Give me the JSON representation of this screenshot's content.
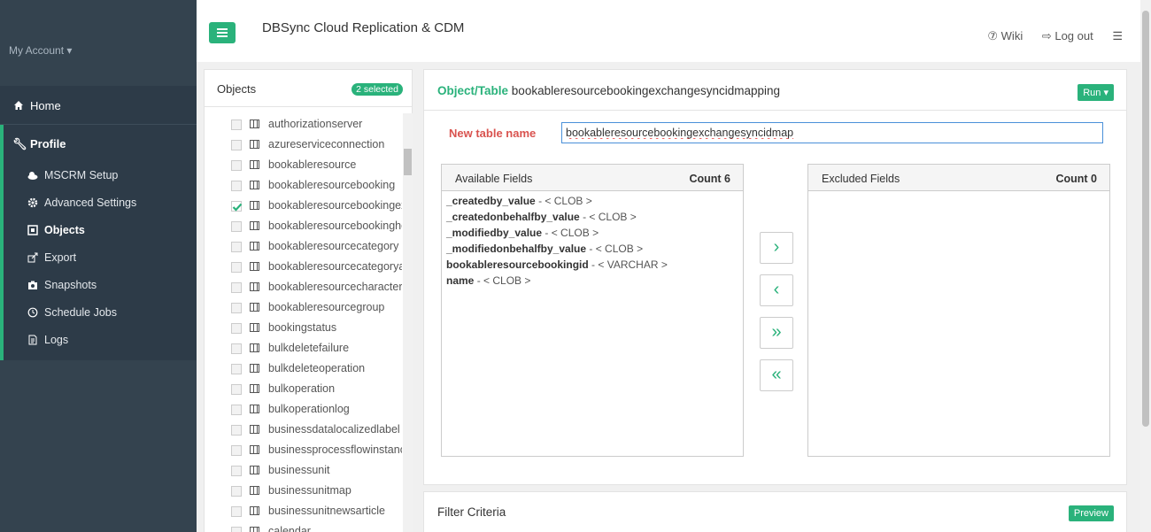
{
  "sidebar": {
    "account_label": "My Account ▾",
    "home_label": "Home",
    "profile_label": "Profile",
    "items": [
      {
        "label": "MSCRM Setup"
      },
      {
        "label": "Advanced Settings"
      },
      {
        "label": "Objects"
      },
      {
        "label": "Export"
      },
      {
        "label": "Snapshots"
      },
      {
        "label": "Schedule Jobs"
      },
      {
        "label": "Logs"
      }
    ]
  },
  "header": {
    "title": "DBSync Cloud Replication & CDM",
    "wiki_label": "⑦ Wiki",
    "logout_label": "⇨ Log out",
    "menu_icon": "hamburger-icon"
  },
  "objects": {
    "title": "Objects",
    "selected_badge": "2 selected",
    "items": [
      {
        "name": "authorizationserver",
        "checked": false
      },
      {
        "name": "azureserviceconnection",
        "checked": false
      },
      {
        "name": "bookableresource",
        "checked": false
      },
      {
        "name": "bookableresourcebooking",
        "checked": false
      },
      {
        "name": "bookableresourcebookingexchangesyncidmapping",
        "checked": true
      },
      {
        "name": "bookableresourcebookingheader",
        "checked": false
      },
      {
        "name": "bookableresourcecategory",
        "checked": false
      },
      {
        "name": "bookableresourcecategoryassn",
        "checked": false
      },
      {
        "name": "bookableresourcecharacteristic",
        "checked": false
      },
      {
        "name": "bookableresourcegroup",
        "checked": false
      },
      {
        "name": "bookingstatus",
        "checked": false
      },
      {
        "name": "bulkdeletefailure",
        "checked": false
      },
      {
        "name": "bulkdeleteoperation",
        "checked": false
      },
      {
        "name": "bulkoperation",
        "checked": false
      },
      {
        "name": "bulkoperationlog",
        "checked": false
      },
      {
        "name": "businessdatalocalizedlabel",
        "checked": false
      },
      {
        "name": "businessprocessflowinstance",
        "checked": false
      },
      {
        "name": "businessunit",
        "checked": false
      },
      {
        "name": "businessunitmap",
        "checked": false
      },
      {
        "name": "businessunitnewsarticle",
        "checked": false
      },
      {
        "name": "calendar",
        "checked": false
      }
    ]
  },
  "object_table": {
    "label_key": "Object/Table",
    "label_value": "bookableresourcebookingexchangesyncidmapping",
    "run_label": "Run ▾",
    "new_table_label": "New table name",
    "new_table_value": "bookableresourcebookingexchangesyncidmap"
  },
  "available_fields": {
    "title": "Available Fields",
    "count": "Count 6",
    "fields": [
      {
        "name": "_createdby_value",
        "type": " - < CLOB >"
      },
      {
        "name": "_createdonbehalfby_value",
        "type": " - < CLOB >"
      },
      {
        "name": "_modifiedby_value",
        "type": " - < CLOB >"
      },
      {
        "name": "_modifiedonbehalfby_value",
        "type": " - < CLOB >"
      },
      {
        "name": "bookableresourcebookingid",
        "type": " - < VARCHAR >"
      },
      {
        "name": "name",
        "type": " - < CLOB >"
      }
    ]
  },
  "excluded_fields": {
    "title": "Excluded Fields",
    "count": "Count 0"
  },
  "transfer": {
    "move_right": "›",
    "move_left": "‹",
    "move_all_right": "»",
    "move_all_left": "«"
  },
  "filter": {
    "title": "Filter Criteria",
    "preview_label": "Preview"
  },
  "colors": {
    "accent": "#2ab27b",
    "sidebar_bg": "#2d3b48",
    "danger_label": "#d9534f"
  }
}
